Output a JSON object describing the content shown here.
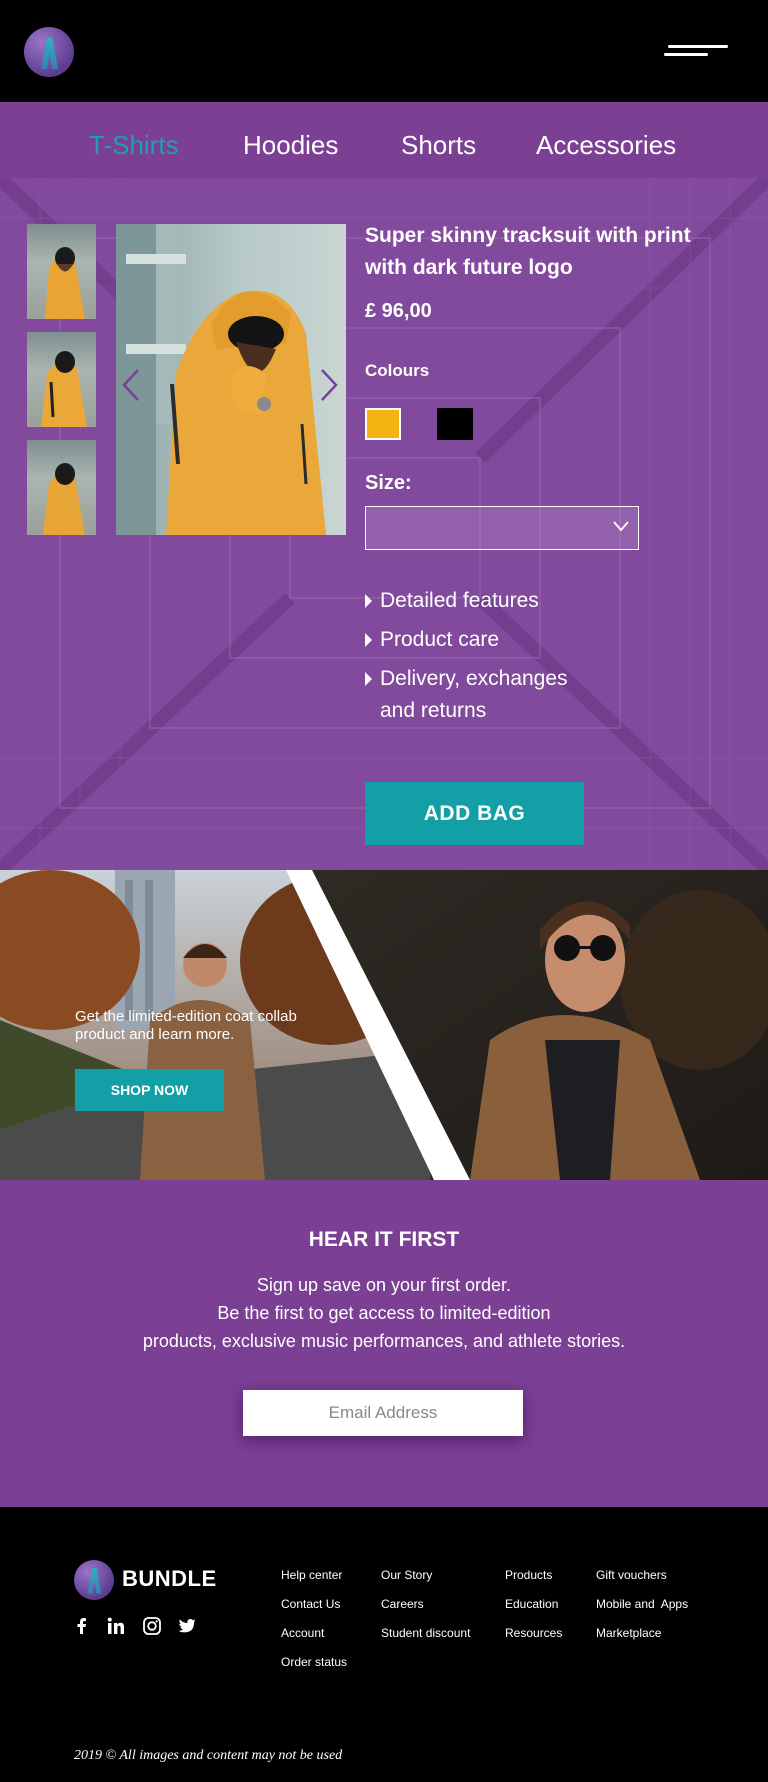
{
  "header": {
    "logo_icon": "bundle-logo-icon",
    "menu_icon": "hamburger-menu-icon"
  },
  "categories": [
    {
      "label": "T-Shirts",
      "active": true
    },
    {
      "label": "Hoodies",
      "active": false
    },
    {
      "label": "Shorts",
      "active": false
    },
    {
      "label": "Accessories",
      "active": false
    }
  ],
  "product": {
    "title": "Super skinny tracksuit with print with dark future logo",
    "price": "£ 96,00",
    "colours_label": "Colours",
    "colours": [
      {
        "name": "yellow",
        "hex": "#f2b20f",
        "selected": true
      },
      {
        "name": "black",
        "hex": "#000000",
        "selected": false
      }
    ],
    "size_label": "Size:",
    "size_value": "",
    "accordion": [
      "Detailed features",
      "Product care",
      "Delivery, exchanges and returns"
    ],
    "add_button": "ADD BAG"
  },
  "promo": {
    "text": "Get the limited-edition coat collab product and learn more.",
    "button": "SHOP NOW"
  },
  "newsletter": {
    "title": "HEAR IT FIRST",
    "lines": [
      "Sign up save on your first order.",
      "Be the first to get access to limited-edition",
      "products, exclusive music performances, and athlete stories."
    ],
    "email_placeholder": "Email Address"
  },
  "footer": {
    "brand": "BUNDLE",
    "social_icons": [
      "facebook-icon",
      "linkedin-icon",
      "instagram-icon",
      "twitter-icon"
    ],
    "columns": [
      [
        "Help center",
        "Contact Us",
        "Account",
        "Order status"
      ],
      [
        "Our Story",
        "Careers",
        "Student discount"
      ],
      [
        "Products",
        "Education",
        "Resources"
      ],
      [
        "Gift vouchers",
        "Mobile and  Apps",
        "Marketplace"
      ]
    ],
    "copyright": "2019 © All images and content may not be used"
  },
  "colors": {
    "purple": "#7b3f94",
    "teal": "#139fa6",
    "active_tab": "#1aa3ab",
    "black": "#000000"
  }
}
